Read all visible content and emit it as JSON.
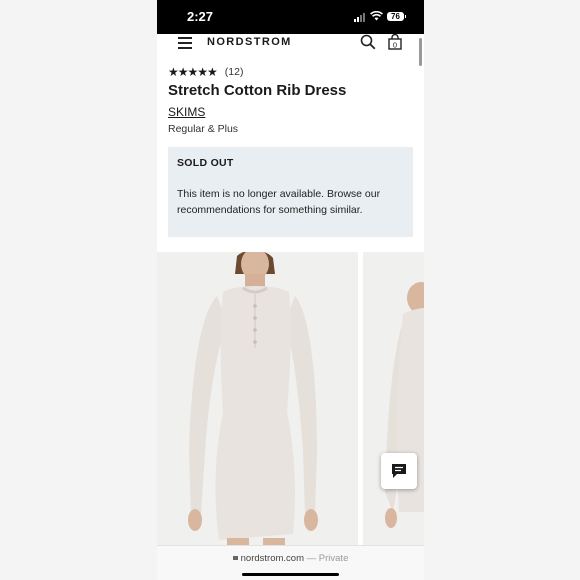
{
  "status_bar": {
    "time": "2:27",
    "battery": "76"
  },
  "header": {
    "brand": "NORDSTROM",
    "bag_count": "0"
  },
  "product": {
    "rating_stars": "★★★★★",
    "review_count": "(12)",
    "title": "Stretch Cotton Rib Dress",
    "brand": "SKIMS",
    "sizes": "Regular & Plus"
  },
  "availability": {
    "status": "SOLD OUT",
    "message": "This item is no longer available. Browse our recommendations for something similar."
  },
  "browser": {
    "domain": "nordstrom.com",
    "mode": "— Private"
  },
  "icons": [
    "menu-icon",
    "search-icon",
    "shopping-bag-icon",
    "chat-icon",
    "lock-icon",
    "wifi-icon",
    "signal-icon"
  ],
  "colors": {
    "notice_bg": "#e9eef2",
    "dress": "#e8e3df"
  }
}
